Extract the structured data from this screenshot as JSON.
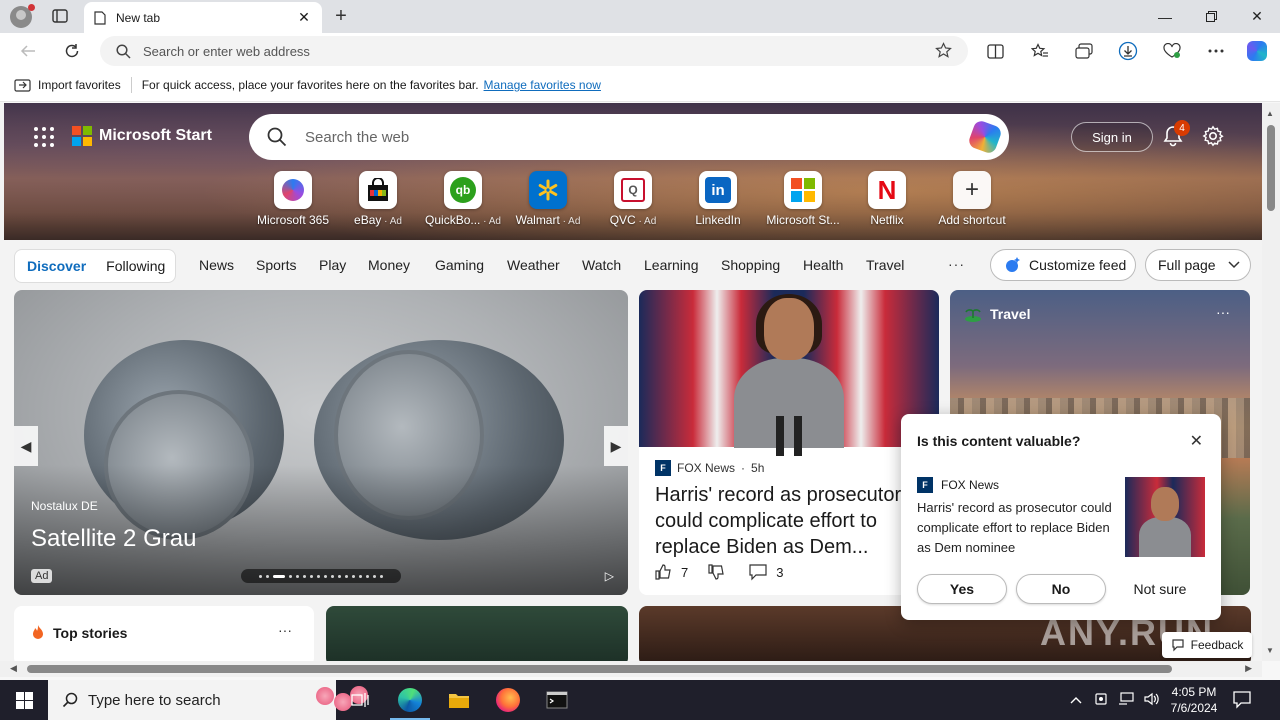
{
  "browser": {
    "tab_title": "New tab",
    "address_placeholder": "Search or enter web address"
  },
  "favorites_bar": {
    "import_label": "Import favorites",
    "message": "For quick access, place your favorites here on the favorites bar.",
    "manage_link": "Manage favorites now"
  },
  "header": {
    "brand": "Microsoft Start",
    "search_placeholder": "Search the web",
    "signin_label": "Sign in",
    "notification_count": "4"
  },
  "shortcuts": [
    {
      "label": "Microsoft 365",
      "ad": ""
    },
    {
      "label": "eBay",
      "ad": " · Ad"
    },
    {
      "label": "QuickBo...",
      "ad": " · Ad"
    },
    {
      "label": "Walmart",
      "ad": " · Ad"
    },
    {
      "label": "QVC",
      "ad": " · Ad"
    },
    {
      "label": "LinkedIn",
      "ad": ""
    },
    {
      "label": "Microsoft St...",
      "ad": ""
    },
    {
      "label": "Netflix",
      "ad": ""
    },
    {
      "label": "Add shortcut",
      "ad": ""
    }
  ],
  "nav": {
    "discover": "Discover",
    "following": "Following",
    "items": [
      "News",
      "Sports",
      "Play",
      "Money",
      "Gaming",
      "Weather",
      "Watch",
      "Learning",
      "Shopping",
      "Health",
      "Travel"
    ],
    "more": "···",
    "customize": "Customize feed",
    "fullpage": "Full page"
  },
  "ad_card": {
    "source": "Nostalux DE",
    "title": "Satellite 2 Grau",
    "ad_tag": "Ad"
  },
  "news_card": {
    "source": "FOX News",
    "age": "5h",
    "title": "Harris' record as prosecutor could complicate effort to replace Biden as Dem...",
    "likes": "7",
    "comments": "3"
  },
  "travel_card": {
    "title": "Travel"
  },
  "top_stories": {
    "title": "Top stories"
  },
  "popup": {
    "question": "Is this content valuable?",
    "source": "FOX News",
    "text": "Harris' record as prosecutor could complicate effort to replace Biden as Dem nominee",
    "yes": "Yes",
    "no": "No",
    "not_sure": "Not sure"
  },
  "feedback_label": "Feedback",
  "watermark": "ANY.RUN",
  "taskbar": {
    "search_placeholder": "Type here to search",
    "time": "4:05 PM",
    "date": "7/6/2024"
  },
  "colors": {
    "accent": "#0f6cbd",
    "taskbar": "#1f1f2b"
  }
}
